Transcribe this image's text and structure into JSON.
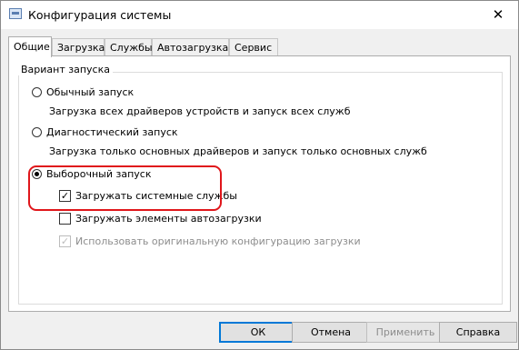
{
  "window": {
    "title": "Конфигурация системы",
    "icon": "msconfig-icon",
    "close_glyph": "✕"
  },
  "tabs": [
    {
      "label": "Общие",
      "active": true
    },
    {
      "label": "Загрузка",
      "active": false
    },
    {
      "label": "Службы",
      "active": false
    },
    {
      "label": "Автозагрузка",
      "active": false
    },
    {
      "label": "Сервис",
      "active": false
    }
  ],
  "startup": {
    "group_label": "Вариант запуска",
    "normal": {
      "label": "Обычный запуск",
      "description": "Загрузка всех драйверов устройств и запуск всех служб",
      "checked": false
    },
    "diagnostic": {
      "label": "Диагностический запуск",
      "description": "Загрузка только основных драйверов и запуск только основных служб",
      "checked": false
    },
    "selective": {
      "label": "Выборочный запуск",
      "checked": true,
      "options": {
        "load_system_services": {
          "label": "Загружать системные службы",
          "checked": true
        },
        "load_startup_items": {
          "label": "Загружать элементы автозагрузки",
          "checked": false
        },
        "use_original_boot_config": {
          "label": "Использовать оригинальную конфигурацию загрузки",
          "checked": true,
          "disabled": true
        }
      },
      "check_glyph": "✓"
    },
    "highlight_color": "#e0161b"
  },
  "buttons": {
    "ok": "ОК",
    "cancel": "Отмена",
    "apply": "Применить",
    "help": "Справка"
  }
}
